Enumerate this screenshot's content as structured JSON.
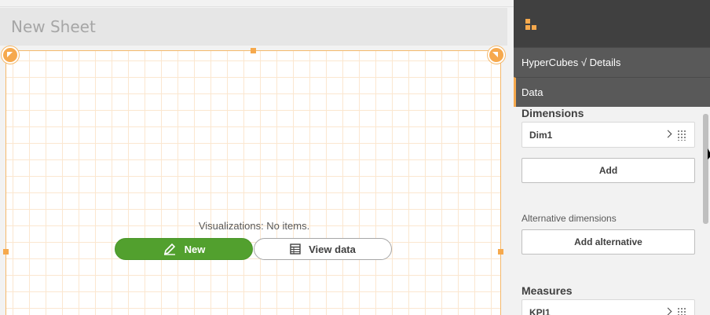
{
  "sheet": {
    "title": "New Sheet",
    "empty_message": "Visualizations: No items.",
    "new_button_label": "New",
    "view_data_button_label": "View data"
  },
  "panel": {
    "icon": "sheet-grid-icon",
    "sections": {
      "hypercubes_label": "HyperCubes √ Details",
      "data_label": "Data"
    },
    "dimensions": {
      "title": "Dimensions",
      "items": [
        {
          "label": "Dim1"
        }
      ],
      "add_label": "Add"
    },
    "alternative_dimensions": {
      "title": "Alternative dimensions",
      "add_label": "Add alternative"
    },
    "measures": {
      "title": "Measures",
      "items": [
        {
          "label": "KPI1"
        }
      ]
    }
  },
  "colors": {
    "accent": "#f6a94d",
    "new_button": "#52a02e",
    "panel_dark": "#404040",
    "panel_section": "#595959"
  }
}
